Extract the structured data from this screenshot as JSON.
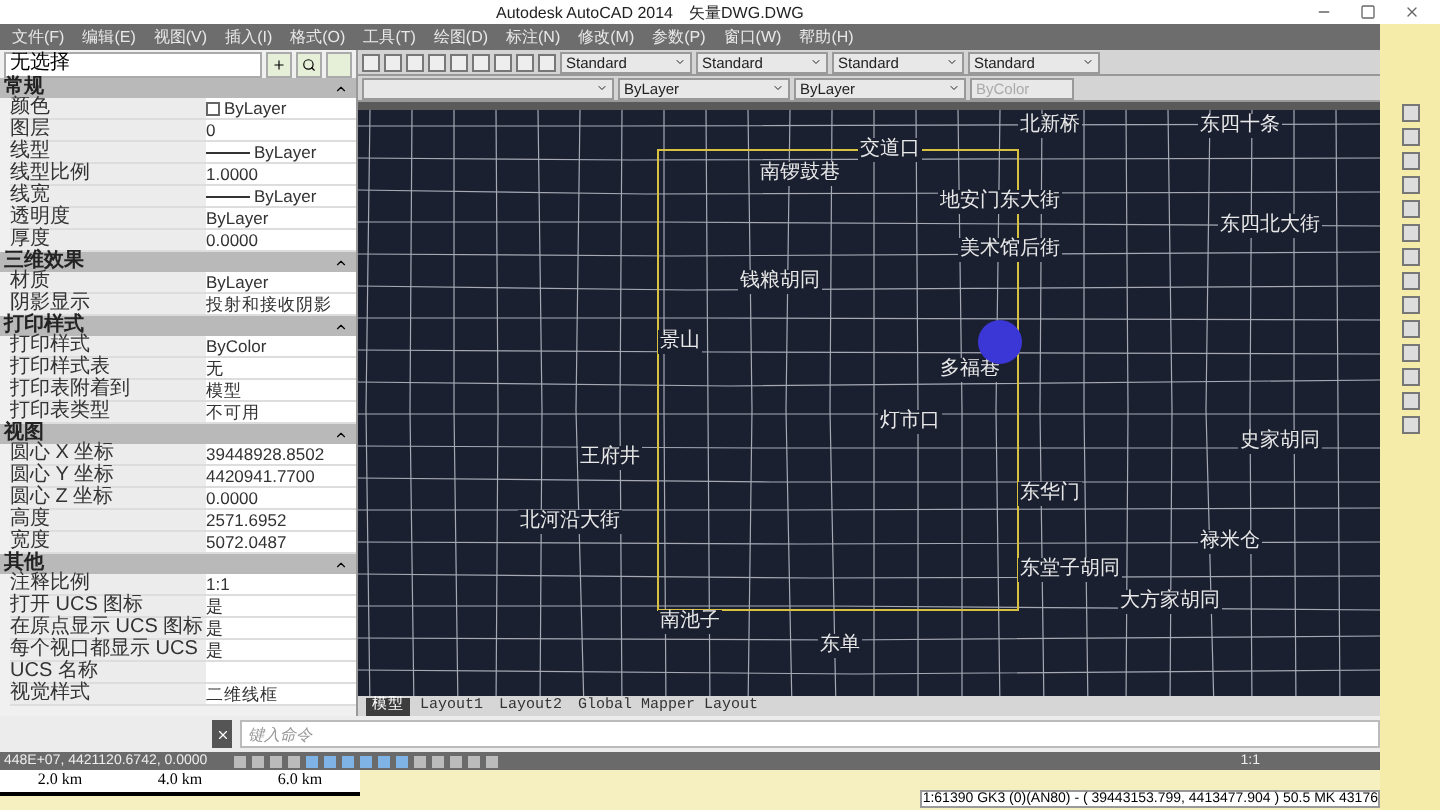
{
  "window": {
    "title": "Autodesk AutoCAD 2014",
    "file": "矢量DWG.DWG"
  },
  "menu": [
    "文件(F)",
    "编辑(E)",
    "视图(V)",
    "插入(I)",
    "格式(O)",
    "工具(T)",
    "绘图(D)",
    "标注(N)",
    "修改(M)",
    "参数(P)",
    "窗口(W)",
    "帮助(H)"
  ],
  "properties": {
    "selection": "无选择",
    "sections": [
      {
        "title": "常规",
        "expanded": true,
        "rows": [
          {
            "label": "颜色",
            "value": "ByLayer",
            "kind": "color"
          },
          {
            "label": "图层",
            "value": "0",
            "kind": "text"
          },
          {
            "label": "线型",
            "value": "ByLayer",
            "kind": "line"
          },
          {
            "label": "线型比例",
            "value": "1.0000",
            "kind": "text"
          },
          {
            "label": "线宽",
            "value": "ByLayer",
            "kind": "line"
          },
          {
            "label": "透明度",
            "value": "ByLayer",
            "kind": "text"
          },
          {
            "label": "厚度",
            "value": "0.0000",
            "kind": "text"
          }
        ]
      },
      {
        "title": "三维效果",
        "expanded": true,
        "rows": [
          {
            "label": "材质",
            "value": "ByLayer",
            "kind": "text"
          },
          {
            "label": "阴影显示",
            "value": "投射和接收阴影",
            "kind": "text"
          }
        ]
      },
      {
        "title": "打印样式",
        "expanded": true,
        "rows": [
          {
            "label": "打印样式",
            "value": "ByColor",
            "kind": "text"
          },
          {
            "label": "打印样式表",
            "value": "无",
            "kind": "text"
          },
          {
            "label": "打印表附着到",
            "value": "模型",
            "kind": "text"
          },
          {
            "label": "打印表类型",
            "value": "不可用",
            "kind": "text"
          }
        ]
      },
      {
        "title": "视图",
        "expanded": true,
        "rows": [
          {
            "label": "圆心 X 坐标",
            "value": "39448928.8502",
            "kind": "text"
          },
          {
            "label": "圆心 Y 坐标",
            "value": "4420941.7700",
            "kind": "text"
          },
          {
            "label": "圆心 Z 坐标",
            "value": "0.0000",
            "kind": "text"
          },
          {
            "label": "高度",
            "value": "2571.6952",
            "kind": "text"
          },
          {
            "label": "宽度",
            "value": "5072.0487",
            "kind": "text"
          }
        ]
      },
      {
        "title": "其他",
        "expanded": true,
        "rows": [
          {
            "label": "注释比例",
            "value": "1:1",
            "kind": "text"
          },
          {
            "label": "打开 UCS 图标",
            "value": "是",
            "kind": "text"
          },
          {
            "label": "在原点显示 UCS 图标",
            "value": "是",
            "kind": "text"
          },
          {
            "label": "每个视口都显示 UCS",
            "value": "是",
            "kind": "text"
          },
          {
            "label": "UCS 名称",
            "kind": "text"
          },
          {
            "label": "视觉样式",
            "value": "二维线框",
            "kind": "text"
          }
        ]
      }
    ]
  },
  "toolbar": {
    "styles": [
      "Standard",
      "Standard",
      "Standard",
      "Standard"
    ],
    "linetype": "ByLayer",
    "lineweight": "ByLayer",
    "plot_style": {
      "value": "ByColor",
      "disabled": true
    }
  },
  "map": {
    "labels": [
      "北新桥",
      "东四十条",
      "交道口",
      "南锣鼓巷",
      "地安门东大街",
      "东四北大街",
      "美术馆后街",
      "钱粮胡同",
      "多福巷",
      "景山",
      "史家胡同",
      "灯市口",
      "王府井",
      "东华门",
      "北河沿大街",
      "禄米仓",
      "东堂子胡同",
      "大方家胡同",
      "南池子",
      "东单"
    ]
  },
  "layout_tabs": [
    {
      "label": "模型",
      "selected": true
    },
    {
      "label": "Layout1",
      "selected": false
    },
    {
      "label": "Layout2",
      "selected": false
    },
    {
      "label": "Global Mapper Layout",
      "selected": false
    }
  ],
  "command": {
    "placeholder": "键入命令"
  },
  "status": {
    "coordinates": "448E+07, 4421120.6742, 0.0000",
    "annotation_scale": "1:1"
  },
  "bottom_map": {
    "scale_labels": [
      "2.0 km",
      "4.0 km",
      "6.0 km"
    ],
    "readout": "1:61390  GK3 (0)(AN80) - ( 39443153.799, 4413477.904 )  50.5 MK 43176"
  }
}
